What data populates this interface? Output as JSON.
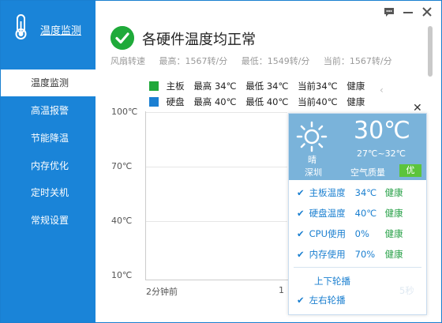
{
  "app": {
    "title": "温度监测"
  },
  "colors": {
    "sidebar": "#1a84d8",
    "ok_green": "#1faa3a",
    "board": "#20a83a",
    "disk": "#1b7fd2",
    "link_blue": "#1a7fd0"
  },
  "sidebar": {
    "items": [
      {
        "label": "温度监测",
        "active": true
      },
      {
        "label": "高温报警",
        "active": false
      },
      {
        "label": "节能降温",
        "active": false
      },
      {
        "label": "内存优化",
        "active": false
      },
      {
        "label": "定时关机",
        "active": false
      },
      {
        "label": "常规设置",
        "active": false
      }
    ]
  },
  "titlebar": {
    "icons": [
      "feedback-icon",
      "minimize-icon",
      "close-icon"
    ]
  },
  "status": {
    "title": "各硬件温度均正常",
    "icon": "check-circle-icon",
    "fan_label": "风扇转速",
    "fan_max": "最高：1567转/分",
    "fan_min": "最低：1549转/分",
    "fan_now": "当前：1567转/分"
  },
  "legend": [
    {
      "name": "主板",
      "max": "最高 34℃",
      "min": "最低 34℃",
      "now": "当前34℃",
      "state": "健康",
      "color": "#20a83a"
    },
    {
      "name": "硬盘",
      "max": "最高 40℃",
      "min": "最低 40℃",
      "now": "当前40℃",
      "state": "健康",
      "color": "#1b7fd2"
    }
  ],
  "chart_data": {
    "type": "line",
    "title": "",
    "y_ticks": [
      "100℃",
      "70℃",
      "40℃",
      "10℃"
    ],
    "x_ticks": [
      "2分钟前",
      "1"
    ],
    "ylim": [
      10,
      100
    ],
    "series": [
      {
        "name": "主板",
        "values": []
      },
      {
        "name": "硬盘",
        "values": []
      }
    ],
    "grid": true
  },
  "popup": {
    "weather": {
      "icon": "sun-icon",
      "condition": "晴",
      "city": "深圳",
      "temp": "30℃",
      "range": "27℃~32℃",
      "aqi_label": "空气质量",
      "aqi_value": "优"
    },
    "checks": [
      {
        "label": "主板温度",
        "value": "34℃",
        "state": "健康"
      },
      {
        "label": "硬盘温度",
        "value": "40℃",
        "state": "健康"
      },
      {
        "label": "CPU使用",
        "value": "0%",
        "state": "健康"
      },
      {
        "label": "内存使用",
        "value": "70%",
        "state": "健康"
      }
    ],
    "rotation": {
      "vertical": "上下轮播",
      "horizontal": "左右轮播",
      "peek": "5秒"
    }
  }
}
